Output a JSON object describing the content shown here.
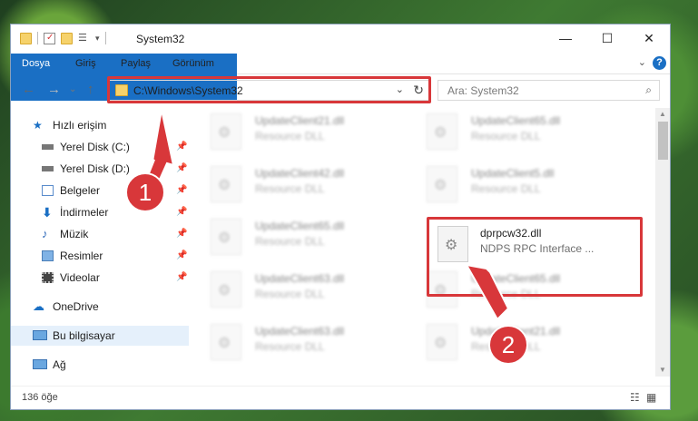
{
  "window": {
    "title": "System32",
    "controls": {
      "minimize": "—",
      "maximize": "☐",
      "close": "✕"
    }
  },
  "ribbon": {
    "tabs": [
      "Dosya",
      "Giriş",
      "Paylaş",
      "Görünüm"
    ],
    "help": "?"
  },
  "address": {
    "path": "C:\\Windows\\System32",
    "search_placeholder": "Ara: System32"
  },
  "sidebar": {
    "items": [
      {
        "label": "Hızlı erişim",
        "icon": "star-icon",
        "pinned": false
      },
      {
        "label": "Yerel Disk (C:)",
        "icon": "drive-icon",
        "pinned": true
      },
      {
        "label": "Yerel Disk (D:)",
        "icon": "drive-icon",
        "pinned": true
      },
      {
        "label": "Belgeler",
        "icon": "documents-icon",
        "pinned": true
      },
      {
        "label": "İndirmeler",
        "icon": "download-icon",
        "pinned": true
      },
      {
        "label": "Müzik",
        "icon": "music-icon",
        "pinned": true
      },
      {
        "label": "Resimler",
        "icon": "pictures-icon",
        "pinned": true
      },
      {
        "label": "Videolar",
        "icon": "videos-icon",
        "pinned": true
      },
      {
        "label": "OneDrive",
        "icon": "cloud-icon",
        "pinned": false
      },
      {
        "label": "Bu bilgisayar",
        "icon": "computer-icon",
        "pinned": false,
        "selected": true
      },
      {
        "label": "Ağ",
        "icon": "network-icon",
        "pinned": false
      }
    ]
  },
  "files": [
    {
      "name": "UpdateClient21.dll",
      "desc": "Resource DLL",
      "blurred": true
    },
    {
      "name": "UpdateClient65.dll",
      "desc": "Resource DLL",
      "blurred": true
    },
    {
      "name": "UpdateClient42.dll",
      "desc": "Resource DLL",
      "blurred": true
    },
    {
      "name": "UpdateClient5.dll",
      "desc": "Resource DLL",
      "blurred": true
    },
    {
      "name": "UpdateClient65.dll",
      "desc": "Resource DLL",
      "blurred": true
    },
    {
      "name": "dprpcw32.dll",
      "desc": "NDPS RPC Interface ...",
      "blurred": false
    },
    {
      "name": "UpdateClient63.dll",
      "desc": "Resource DLL",
      "blurred": true
    },
    {
      "name": "UpdateClient65.dll",
      "desc": "Resource DLL",
      "blurred": true
    },
    {
      "name": "UpdateClient63.dll",
      "desc": "Resource DLL",
      "blurred": true
    },
    {
      "name": "UpdateClient21.dll",
      "desc": "Resource DLL",
      "blurred": true
    }
  ],
  "status": {
    "count": "136 öğe"
  },
  "callouts": {
    "one": "1",
    "two": "2"
  },
  "colors": {
    "accent": "#1a6fc4",
    "highlight": "#d8373a"
  }
}
